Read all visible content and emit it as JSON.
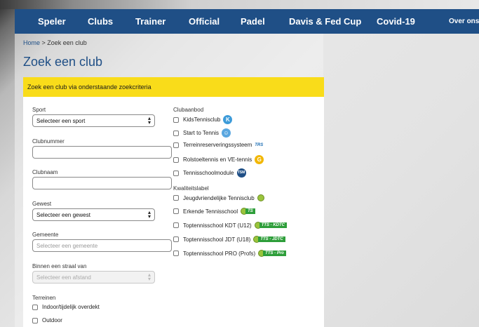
{
  "nav": {
    "items": [
      "Speler",
      "Clubs",
      "Trainer",
      "Official",
      "Padel",
      "Davis & Fed Cup",
      "Covid-19",
      "Over ons"
    ]
  },
  "breadcrumb": {
    "home": "Home",
    "separator": " > ",
    "current": "Zoek een club"
  },
  "page_title": "Zoek een club",
  "panel_header": "Zoek een club via onderstaande zoekcriteria",
  "form": {
    "sport_label": "Sport",
    "sport_value": "Selecteer een sport",
    "clubnummer_label": "Clubnummer",
    "clubnaam_label": "Clubnaam",
    "gewest_label": "Gewest",
    "gewest_value": "Selecteer een gewest",
    "gemeente_label": "Gemeente",
    "gemeente_placeholder": "Selecteer een gemeente",
    "straal_label": "Binnen een straal van",
    "straal_value": "Selecteer een afstand",
    "terreinen_label": "Terreinen",
    "terreinen": [
      "Indoor/tijdelijk overdekt",
      "Outdoor"
    ]
  },
  "clubaanbod": {
    "label": "Clubaanbod",
    "items": [
      "KidsTennisclub",
      "Start to Tennis",
      "Terreinreserveringssysteem",
      "Rolstoeltennis en VE-tennis",
      "Tennisschoolmodule"
    ],
    "badge_text": [
      "K",
      "",
      "TRS",
      "G",
      "TSM"
    ],
    "badge_colors": [
      "#3d9bd9",
      "#5aa7e0",
      "#1f6fb5",
      "#f2b705",
      "#1f4f86"
    ]
  },
  "kwaliteitslabel": {
    "label": "Kwaliteitslabel",
    "items": [
      "Jeugdvriendelijke Tennisclub",
      "Erkende Tennisschool",
      "Toptennisschool KDT (U12)",
      "Toptennisschool JDT (U18)",
      "Toptennisschool PRO (Profs)"
    ],
    "badge_text": [
      "",
      "TS",
      "TTS - KDTC",
      "TTS - JDTC",
      "TTS - Pro"
    ]
  }
}
